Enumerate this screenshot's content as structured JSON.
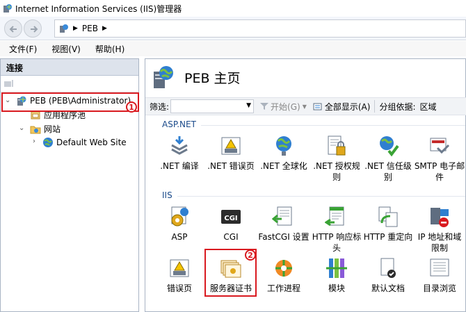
{
  "window": {
    "title": "Internet Information Services (IIS)管理器"
  },
  "address": {
    "path": "PEB"
  },
  "menu": [
    "文件(F)",
    "视图(V)",
    "帮助(H)"
  ],
  "connections": {
    "heading": "连接",
    "tree": [
      {
        "label": "PEB (PEB\\Administrator)",
        "icon": "server-icon"
      },
      {
        "label": "应用程序池",
        "icon": "app-pool-icon"
      },
      {
        "label": "网站",
        "icon": "sites-folder-icon"
      },
      {
        "label": "Default Web Site",
        "icon": "globe-icon"
      }
    ]
  },
  "main": {
    "title": "PEB 主页",
    "filter": {
      "label": "筛选:",
      "start": "开始(G)",
      "show_all": "全部显示(A)",
      "group_by_label": "分组依据:",
      "group_by_value": "区域"
    },
    "sections": [
      {
        "name": "ASP.NET",
        "features": [
          {
            "label": ".NET 编译",
            "icon": "net-compile-icon"
          },
          {
            "label": ".NET 错误页",
            "icon": "net-error-pages-icon"
          },
          {
            "label": ".NET 全球化",
            "icon": "net-globalization-icon"
          },
          {
            "label": ".NET 授权规则",
            "icon": "net-authorization-icon"
          },
          {
            "label": ".NET 信任级别",
            "icon": "net-trust-icon"
          },
          {
            "label": "SMTP 电子邮件",
            "icon": "smtp-icon"
          }
        ]
      },
      {
        "name": "IIS",
        "features": [
          {
            "label": "ASP",
            "icon": "asp-icon"
          },
          {
            "label": "CGI",
            "icon": "cgi-icon"
          },
          {
            "label": "FastCGI 设置",
            "icon": "fastcgi-icon"
          },
          {
            "label": "HTTP 响应标头",
            "icon": "http-headers-icon"
          },
          {
            "label": "HTTP 重定向",
            "icon": "http-redirect-icon"
          },
          {
            "label": "IP 地址和域限制",
            "icon": "ip-restrict-icon"
          },
          {
            "label": "错误页",
            "icon": "error-pages-icon"
          },
          {
            "label": "服务器证书",
            "icon": "server-certificates-icon"
          },
          {
            "label": "工作进程",
            "icon": "worker-process-icon"
          },
          {
            "label": "模块",
            "icon": "modules-icon"
          },
          {
            "label": "默认文档",
            "icon": "default-doc-icon"
          },
          {
            "label": "目录浏览",
            "icon": "dir-browse-icon"
          }
        ]
      }
    ]
  },
  "annotations": {
    "badge1": "1",
    "badge2": "2",
    "color": "#d9191f"
  }
}
